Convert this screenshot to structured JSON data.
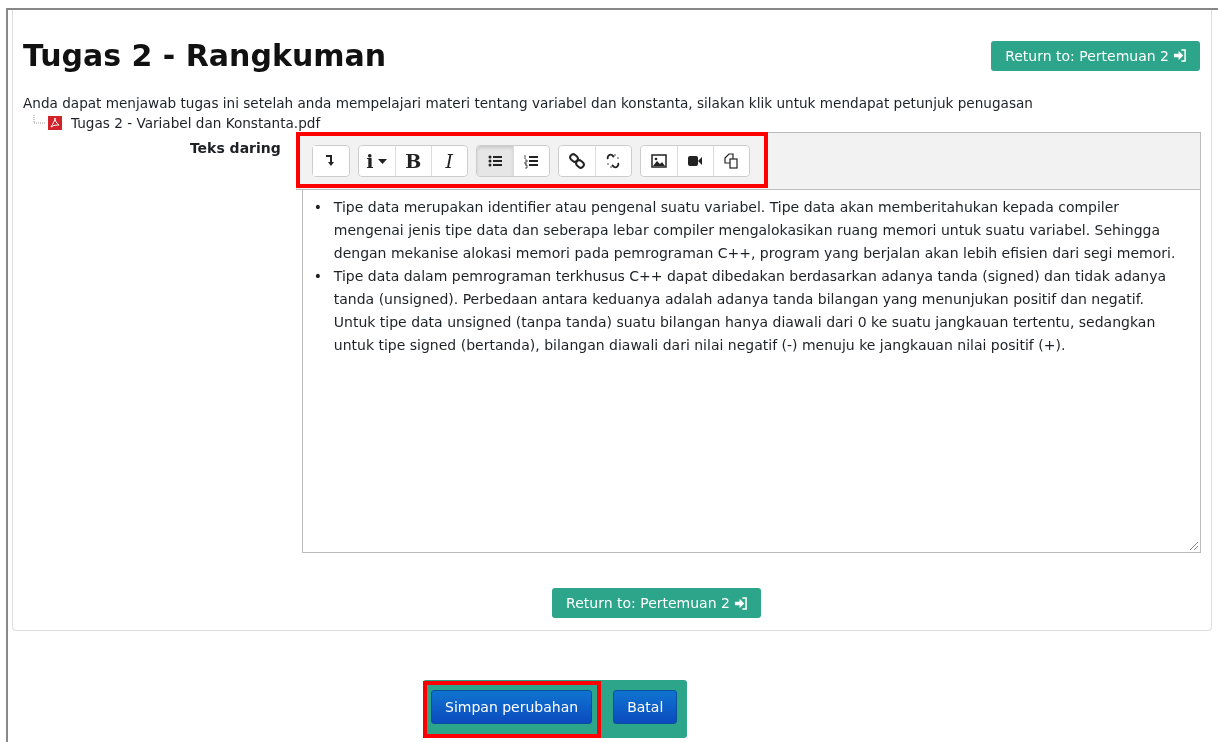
{
  "page": {
    "title": "Tugas 2 - Rangkuman",
    "return_button": "Return to: Pertemuan 2",
    "intro": "Anda dapat menjawab tugas ini setelah anda mempelajari materi tentang variabel dan konstanta, silakan klik untuk mendapat petunjuk penugasan",
    "attachment": "Tugas 2 - Variabel dan Konstanta.pdf"
  },
  "editor": {
    "label": "Teks daring",
    "toolbar_highlighted": true,
    "toolbar_groups": [
      [
        {
          "kind": "collapse",
          "on": false
        }
      ],
      [
        {
          "kind": "info",
          "label": "i",
          "on": false
        },
        {
          "kind": "bold",
          "label": "B",
          "on": false
        },
        {
          "kind": "italic",
          "label": "I",
          "on": false
        }
      ],
      [
        {
          "kind": "bullets",
          "on": true
        },
        {
          "kind": "numbers",
          "on": false
        }
      ],
      [
        {
          "kind": "link",
          "on": false
        },
        {
          "kind": "unlink",
          "on": false
        }
      ],
      [
        {
          "kind": "image",
          "on": false
        },
        {
          "kind": "video",
          "on": false
        },
        {
          "kind": "files",
          "on": false
        }
      ]
    ],
    "items": [
      {
        "bullet": "•",
        "text": "Tipe data merupakan identifier atau pengenal suatu variabel. Tipe data akan memberitahukan kepada compiler mengenai jenis tipe data dan seberapa lebar compiler mengalokasikan ruang memori untuk suatu variabel. Sehingga dengan mekanise alokasi memori pada pemrograman C++, program yang berjalan akan lebih efisien dari segi memori."
      },
      {
        "bullet": "•",
        "text": "Tipe data dalam pemrograman terkhusus C++ dapat dibedakan berdasarkan adanya tanda (signed) dan tidak adanya tanda (unsigned). Perbedaan antara keduanya adalah adanya tanda bilangan yang menunjukan positif dan negatif. Untuk tipe data unsigned (tanpa tanda) suatu bilangan hanya diawali dari 0 ke suatu jangkauan tertentu, sedangkan untuk tipe signed (bertanda), bilangan diawali dari nilai negatif (-) menuju ke jangkauan nilai positif (+)."
      }
    ]
  },
  "bottom_return_button": "Return to: Pertemuan 2",
  "actions": [
    {
      "kind": "primary",
      "label": "Simpan perubahan",
      "highlighted": true
    },
    {
      "kind": "primary",
      "label": "Batal",
      "highlighted": false
    }
  ]
}
